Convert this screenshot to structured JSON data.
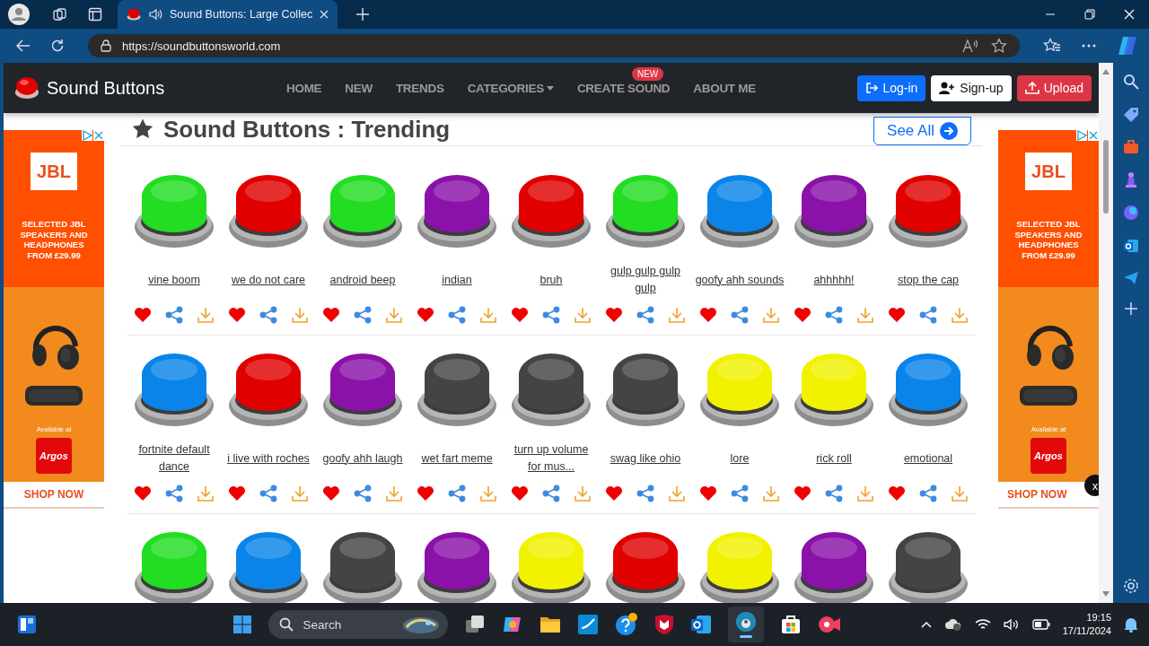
{
  "browser": {
    "tab_title": "Sound Buttons: Large Collec",
    "url": "https://soundbuttonsworld.com"
  },
  "navbar": {
    "brand": "Sound Buttons",
    "links": [
      {
        "label": "HOME",
        "dropdown": false
      },
      {
        "label": "NEW",
        "dropdown": false
      },
      {
        "label": "TRENDS",
        "dropdown": false
      },
      {
        "label": "CATEGORIES",
        "dropdown": true
      },
      {
        "label": "CREATE SOUND",
        "dropdown": false,
        "badge": "NEW"
      },
      {
        "label": "ABOUT ME",
        "dropdown": false
      }
    ],
    "buttons": [
      {
        "label": "Log-in",
        "kind": "login"
      },
      {
        "label": "Sign-up",
        "kind": "signup"
      },
      {
        "label": "Upload",
        "kind": "upload"
      }
    ]
  },
  "section": {
    "title": "Sound Buttons : Trending",
    "see_all": "See All"
  },
  "ads": [
    {
      "logo": "JBL",
      "headline": "SELECTED JBL SPEAKERS AND HEADPHONES FROM £29.99",
      "available": "Available at",
      "retailer": "Argos",
      "cta": "SHOP NOW"
    },
    {
      "logo": "JBL",
      "headline": "SELECTED JBL SPEAKERS AND HEADPHONES FROM £29.99",
      "available": "Available at",
      "retailer": "Argos",
      "cta": "SHOP NOW",
      "close": "x"
    }
  ],
  "rows": [
    {
      "buttons": [
        {
          "label": "vine boom",
          "color": "#22dd22"
        },
        {
          "label": "we do not care",
          "color": "#e00000"
        },
        {
          "label": "android beep",
          "color": "#22dd22"
        },
        {
          "label": "indian",
          "color": "#8a12a8"
        },
        {
          "label": "bruh",
          "color": "#e00000"
        },
        {
          "label": "gulp gulp gulp gulp",
          "color": "#22dd22"
        },
        {
          "label": "goofy ahh sounds",
          "color": "#0a84e8"
        },
        {
          "label": "ahhhhh!",
          "color": "#8a12a8"
        },
        {
          "label": "stop the cap",
          "color": "#e00000"
        }
      ]
    },
    {
      "buttons": [
        {
          "label": "fortnite default dance",
          "color": "#0a84e8"
        },
        {
          "label": "i live with roches",
          "color": "#e00000"
        },
        {
          "label": "goofy ahh laugh",
          "color": "#8a12a8"
        },
        {
          "label": "wet fart meme",
          "color": "#444444"
        },
        {
          "label": "turn up volume for mus...",
          "color": "#444444"
        },
        {
          "label": "swag like ohio",
          "color": "#444444"
        },
        {
          "label": "lore",
          "color": "#f2f200"
        },
        {
          "label": "rick roll",
          "color": "#f2f200"
        },
        {
          "label": "emotional",
          "color": "#0a84e8"
        }
      ]
    },
    {
      "buttons": [
        {
          "color": "#22dd22"
        },
        {
          "color": "#0a84e8"
        },
        {
          "color": "#444444"
        },
        {
          "color": "#8a12a8"
        },
        {
          "color": "#f2f200"
        },
        {
          "color": "#e00000"
        },
        {
          "color": "#f2f200"
        },
        {
          "color": "#8a12a8"
        },
        {
          "color": "#444444"
        }
      ]
    }
  ],
  "taskbar": {
    "search": "Search",
    "time": "19:15",
    "date": "17/11/2024"
  }
}
